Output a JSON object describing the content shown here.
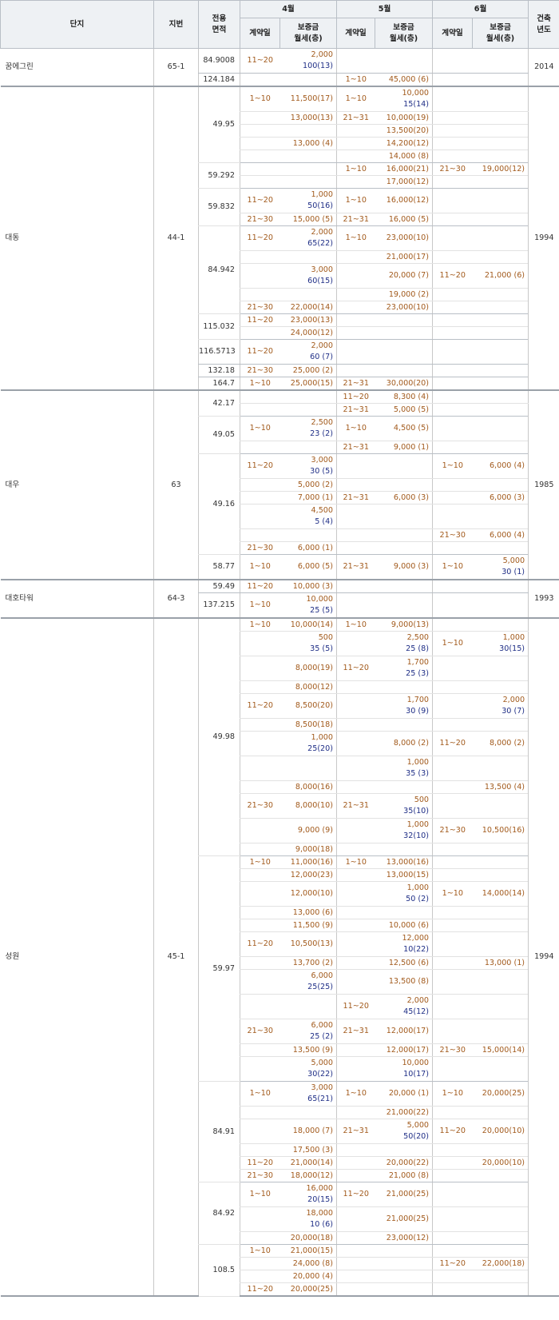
{
  "header": {
    "complex": "단지",
    "lot": "지번",
    "area": "전용\n면적",
    "month4": "4월",
    "month5": "5월",
    "month6": "6월",
    "built": "건축\n년도",
    "contract_day": "계약일",
    "deposit": "보증금\n월세(층)"
  },
  "rows": [
    {
      "name": "꿈에그린",
      "lot": "65-1",
      "area": "84.9008",
      "d4": "11~20",
      "v4": "2,000",
      "r4": "100(13)",
      "built": "2014"
    },
    {
      "area": "124.184",
      "d5": "1~10",
      "v5": "45,000  (6)"
    },
    {
      "name": "대동",
      "lot": "44-1",
      "area": "49.95",
      "d4": "1~10",
      "v4": "11,500(17)",
      "d5": "1~10",
      "v5": "10,000",
      "r5": "15(14)",
      "built": "1994"
    },
    {
      "d5": "21~31",
      "v4": "13,000(13)",
      "v5": "10,000(19)"
    },
    {
      "v5": "13,500(20)"
    },
    {
      "v4": "13,000  (4)",
      "v5": "14,200(12)"
    },
    {
      "v5": "14,000  (8)"
    },
    {
      "area": "59.292",
      "d5": "1~10",
      "v5": "16,000(21)",
      "d6": "21~30",
      "v6": "19,000(12)"
    },
    {
      "v5": "17,000(12)"
    },
    {
      "area": "59.832",
      "d4": "11~20",
      "v4": "1,000",
      "r4": "50(16)",
      "d5": "1~10",
      "v5": "16,000(12)"
    },
    {
      "d4": "21~30",
      "v4": "15,000  (5)",
      "d5": "21~31",
      "v5": "16,000  (5)"
    },
    {
      "area": "84.942",
      "d4": "11~20",
      "v4": "2,000",
      "r4": "65(22)",
      "d5": "1~10",
      "v5": "23,000(10)"
    },
    {
      "v5": "21,000(17)"
    },
    {
      "v4": "3,000",
      "r4": "60(15)",
      "v5": "20,000  (7)",
      "d6": "11~20",
      "v6": "21,000  (6)"
    },
    {
      "v5": "19,000  (2)"
    },
    {
      "d4": "21~30",
      "v4": "22,000(14)",
      "v5": "23,000(10)"
    },
    {
      "area": "115.032",
      "d4": "11~20",
      "v4": "23,000(13)"
    },
    {
      "v4": "24,000(12)"
    },
    {
      "area": "116.5713",
      "d4": "11~20",
      "v4": "2,000",
      "r4": "60  (7)"
    },
    {
      "area": "132.18",
      "d4": "21~30",
      "v4": "25,000  (2)"
    },
    {
      "area": "164.7",
      "d4": "1~10",
      "v4": "25,000(15)",
      "d5": "21~31",
      "v5": "30,000(20)"
    },
    {
      "name": "대우",
      "lot": "63",
      "area": "42.17",
      "d5": "11~20",
      "v5": "8,300  (4)",
      "built": "1985"
    },
    {
      "d5": "21~31",
      "v5": "5,000  (5)"
    },
    {
      "area": "49.05",
      "d4": "1~10",
      "v4": "2,500",
      "r4": "23  (2)",
      "d5": "1~10",
      "v5": "4,500  (5)"
    },
    {
      "d5": "21~31",
      "v5": "9,000  (1)"
    },
    {
      "area": "49.16",
      "d4": "11~20",
      "v4": "3,000",
      "r4": "30  (5)",
      "d6": "1~10",
      "v6": "6,000  (4)"
    },
    {
      "v4": "5,000  (2)"
    },
    {
      "v4": "7,000  (1)",
      "d5": "21~31",
      "v5": "6,000  (3)",
      "v6": "6,000  (3)"
    },
    {
      "v4": "4,500",
      "r4": "5  (4)"
    },
    {
      "d6": "21~30",
      "v6": "6,000  (4)"
    },
    {
      "d4": "21~30",
      "v4": "6,000  (1)"
    },
    {
      "area": "58.77",
      "d4": "1~10",
      "v4": "6,000  (5)",
      "d5": "21~31",
      "v5": "9,000  (3)",
      "d6": "1~10",
      "v6": "5,000",
      "r6": "30  (1)"
    },
    {
      "name": "대호타워",
      "lot": "64-3",
      "area": "59.49",
      "d4": "11~20",
      "v4": "10,000  (3)",
      "built": "1993"
    },
    {
      "area": "137.215",
      "d4": "1~10",
      "v4": "10,000",
      "r4": "25  (5)"
    },
    {
      "name": "성원",
      "lot": "45-1",
      "area": "49.98",
      "d4": "1~10",
      "v4": "10,000(14)",
      "d5": "1~10",
      "v5": "9,000(13)",
      "built": "1994"
    },
    {
      "v4": "500",
      "r4": "35  (5)",
      "v5": "2,500",
      "r5": "25  (8)",
      "d6": "1~10",
      "v6": "1,000",
      "r6": "30(15)"
    },
    {
      "v4": "8,000(19)",
      "d5": "11~20",
      "v5": "1,700",
      "r5": "25  (3)"
    },
    {
      "v4": "8,000(12)"
    },
    {
      "d4": "11~20",
      "v4": "8,500(20)",
      "v5": "1,700",
      "r5": "30  (9)",
      "v6": "2,000",
      "r6": "30  (7)"
    },
    {
      "v4": "8,500(18)"
    },
    {
      "v4": "1,000",
      "r4": "25(20)",
      "v5": "8,000  (2)",
      "d6": "11~20",
      "v6": "8,000  (2)"
    },
    {
      "v5": "1,000",
      "r5": "35  (3)"
    },
    {
      "v4": "8,000(16)",
      "v6": "13,500  (4)"
    },
    {
      "d4": "21~30",
      "v4": "8,000(10)",
      "d5": "21~31",
      "v5": "500",
      "r5": "35(10)"
    },
    {
      "v4": "9,000  (9)",
      "v5": "1,000",
      "r5": "32(10)",
      "d6": "21~30",
      "v6": "10,500(16)"
    },
    {
      "v4": "9,000(18)"
    },
    {
      "area": "59.97",
      "d4": "1~10",
      "v4": "11,000(16)",
      "d5": "1~10",
      "v5": "13,000(16)"
    },
    {
      "v4": "12,000(23)",
      "v5": "13,000(15)"
    },
    {
      "v4": "12,000(10)",
      "v5": "1,000",
      "r5": "50  (2)",
      "d6": "1~10",
      "v6": "14,000(14)"
    },
    {
      "v4": "13,000  (6)"
    },
    {
      "v4": "11,500  (9)",
      "v5": "10,000  (6)"
    },
    {
      "d4": "11~20",
      "v4": "10,500(13)",
      "v5": "12,000",
      "r5": "10(22)"
    },
    {
      "v4": "13,700  (2)",
      "v5": "12,500  (6)",
      "v6": "13,000  (1)"
    },
    {
      "v4": "6,000",
      "r4": "25(25)",
      "v5": "13,500  (8)"
    },
    {
      "d5": "11~20",
      "v5": "2,000",
      "r5": "45(12)"
    },
    {
      "d4": "21~30",
      "v4": "6,000",
      "r4": "25  (2)",
      "d5": "21~31",
      "v5": "12,000(17)"
    },
    {
      "v4": "13,500  (9)",
      "v5": "12,000(17)",
      "d6": "21~30",
      "v6": "15,000(14)"
    },
    {
      "v4": "5,000",
      "r4": "30(22)",
      "v5": "10,000",
      "r5": "10(17)"
    },
    {
      "area": "84.91",
      "d4": "1~10",
      "v4": "3,000",
      "r4": "65(21)",
      "d5": "1~10",
      "v5": "20,000  (1)",
      "d6": "1~10",
      "v6": "20,000(25)"
    },
    {
      "v5": "21,000(22)"
    },
    {
      "v4": "18,000  (7)",
      "d5": "21~31",
      "v5": "5,000",
      "r5": "50(20)",
      "d6": "11~20",
      "v6": "20,000(10)"
    },
    {
      "v4": "17,500  (3)"
    },
    {
      "d4": "11~20",
      "v4": "21,000(14)",
      "v5": "20,000(22)",
      "v6": "20,000(10)"
    },
    {
      "d4": "21~30",
      "v4": "18,000(12)",
      "v5": "21,000  (8)"
    },
    {
      "area": "84.92",
      "d4": "1~10",
      "v4": "16,000",
      "r4": "20(15)",
      "d5": "11~20",
      "v5": "21,000(25)"
    },
    {
      "v4": "18,000",
      "r4": "10  (6)",
      "v5": "21,000(25)"
    },
    {
      "v4": "20,000(18)",
      "v5": "23,000(12)"
    },
    {
      "area": "108.5",
      "d4": "1~10",
      "v4": "21,000(15)"
    },
    {
      "v4": "24,000  (8)",
      "d6": "11~20",
      "v6": "22,000(18)"
    },
    {
      "v4": "20,000  (4)"
    },
    {
      "d4": "11~20",
      "v4": "20,000(25)"
    }
  ]
}
